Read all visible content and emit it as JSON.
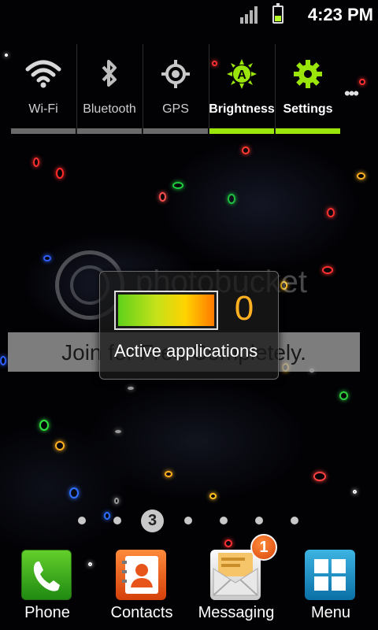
{
  "status_bar": {
    "time": "4:23 PM",
    "icons": [
      "signal-icon",
      "battery-icon"
    ]
  },
  "quick_panel": {
    "toggles": [
      {
        "label": "Wi-Fi",
        "icon": "wifi-icon",
        "on": false
      },
      {
        "label": "Bluetooth",
        "icon": "bluetooth-icon",
        "on": false
      },
      {
        "label": "GPS",
        "icon": "gps-icon",
        "on": false
      },
      {
        "label": "Brightness",
        "icon": "brightness-auto-icon",
        "on": true
      },
      {
        "label": "Settings",
        "icon": "gear-icon",
        "on": true
      }
    ],
    "more_icon": "more-dots-icon",
    "colors": {
      "active": "#9be60a",
      "inactive": "#6a6a6a"
    }
  },
  "task_widget": {
    "count": "0",
    "label": "Active applications"
  },
  "watermark": {
    "logo_text": "photobucket",
    "band_text": "Join for Free Completely."
  },
  "home": {
    "current_page": "3",
    "page_count": 7
  },
  "dock": {
    "items": [
      {
        "label": "Phone",
        "icon": "phone-icon"
      },
      {
        "label": "Contacts",
        "icon": "contacts-icon"
      },
      {
        "label": "Messaging",
        "icon": "messaging-icon",
        "badge": "1"
      },
      {
        "label": "Menu",
        "icon": "menu-grid-icon"
      }
    ]
  }
}
